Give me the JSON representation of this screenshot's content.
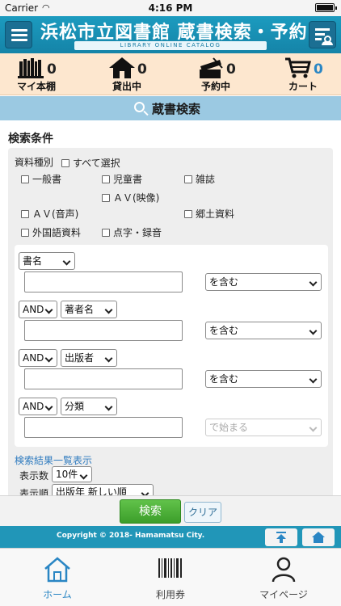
{
  "status_bar": {
    "carrier": "Carrier",
    "time": "4:16 PM"
  },
  "header": {
    "title": "浜松市立図書館 蔵書検索・予約",
    "subtitle": "LIBRARY ONLINE CATALOG"
  },
  "quick_nav": [
    {
      "label": "マイ本棚",
      "count": "0",
      "icon": "bookshelf-icon",
      "count_color": "#f08a00"
    },
    {
      "label": "貸出中",
      "count": "0",
      "icon": "house-icon",
      "count_color": "#f08a00"
    },
    {
      "label": "予約中",
      "count": "0",
      "icon": "reserve-icon",
      "count_color": "#f08a00"
    },
    {
      "label": "カート",
      "count": "0",
      "icon": "cart-icon",
      "count_color": "#2a86c4"
    }
  ],
  "banner": {
    "label": "蔵書検索"
  },
  "search": {
    "section_title": "検索条件",
    "material_type": {
      "label": "資料種別",
      "select_all": "すべて選択",
      "options": [
        "一般書",
        "児童書",
        "雑誌",
        "ＡＶ(映像)",
        "ＡＶ(音声)",
        "郷土資料",
        "外国語資料",
        "点字・録音"
      ]
    },
    "rows": [
      {
        "field": "書名",
        "match": "を含む"
      },
      {
        "op": "AND",
        "field": "著者名",
        "match": "を含む"
      },
      {
        "op": "AND",
        "field": "出版者",
        "match": "を含む"
      },
      {
        "op": "AND",
        "field": "分類",
        "match": "で始まる"
      }
    ],
    "result_display": {
      "label": "検索結果一覧表示",
      "count_label": "表示数",
      "count_value": "10件",
      "order_label": "表示順",
      "order_value": "出版年 新しい順"
    }
  },
  "actions": {
    "search": "検索",
    "clear": "クリア"
  },
  "footer": {
    "copyright": "Copyright © 2018- Hamamatsu City."
  },
  "tabs": [
    {
      "label": "ホーム",
      "icon": "home-icon"
    },
    {
      "label": "利用券",
      "icon": "barcode-icon"
    },
    {
      "label": "マイページ",
      "icon": "person-icon"
    }
  ],
  "colors": {
    "header": "#1c9bbf",
    "accent": "#2a86c4",
    "search_button": "#4cae36",
    "quick_nav_bg": "#fde7cf"
  }
}
